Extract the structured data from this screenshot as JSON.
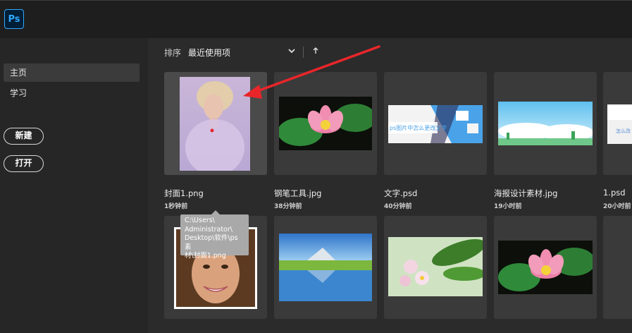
{
  "app": {
    "logo_text": "Ps"
  },
  "sidebar": {
    "items": [
      {
        "label": "主页",
        "active": true
      },
      {
        "label": "学习",
        "active": false
      }
    ],
    "new_label": "新建",
    "open_label": "打开"
  },
  "sort": {
    "label": "排序",
    "value": "最近使用项"
  },
  "files": [
    {
      "name": "封面1.png",
      "time": "1秒钟前"
    },
    {
      "name": "钢笔工具.jpg",
      "time": "38分钟前"
    },
    {
      "name": "文字.psd",
      "time": "40分钟前"
    },
    {
      "name": "海报设计素材.jpg",
      "time": "19小时前"
    },
    {
      "name": "1.psd",
      "time": "20小时前"
    }
  ],
  "thumb_texts": {
    "text_psd": "ps图片中怎么更改文字",
    "one_psd": "怎么改"
  },
  "tooltip": {
    "lines": [
      "C:\\Users\\",
      "Administrator\\",
      "Desktop\\软件\\ps素",
      "材\\封面1.png"
    ]
  },
  "colors": {
    "ps_accent": "#31a8ff",
    "annotation_arrow": "#e8262a",
    "background": "#2b2b2b"
  }
}
